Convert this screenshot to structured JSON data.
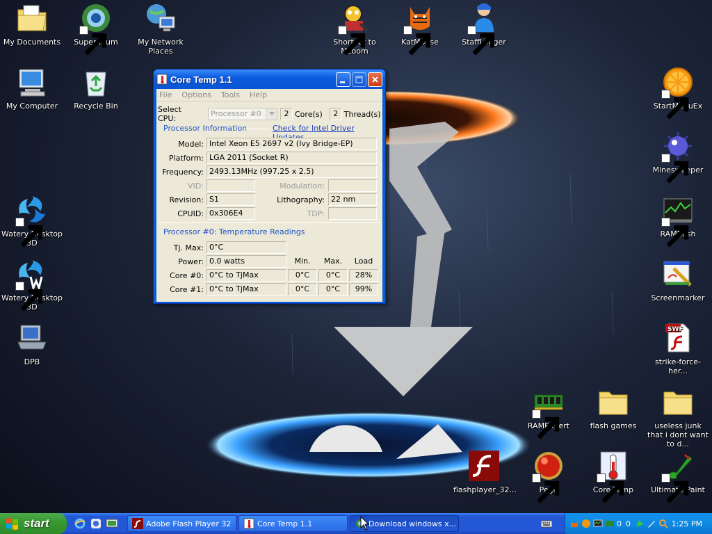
{
  "desktop": {
    "icons": [
      {
        "id": "my-documents",
        "label": "My Documents"
      },
      {
        "id": "supermium",
        "label": "Supermium"
      },
      {
        "id": "my-network-places",
        "label": "My Network Places"
      },
      {
        "id": "mzoom",
        "label": "Shortcut to Mzoom"
      },
      {
        "id": "katmouse",
        "label": "KatMouse"
      },
      {
        "id": "stafflogger",
        "label": "StaffLogger"
      },
      {
        "id": "my-computer",
        "label": "My Computer"
      },
      {
        "id": "recycle-bin",
        "label": "Recycle Bin"
      },
      {
        "id": "startmenuex",
        "label": "StartMenuEx"
      },
      {
        "id": "minesweeper",
        "label": "Minesweeper"
      },
      {
        "id": "watery-1",
        "label": "Watery Desktop 3D"
      },
      {
        "id": "ramrush",
        "label": "RAMRush"
      },
      {
        "id": "watery-2",
        "label": "Watery Desktop 3D"
      },
      {
        "id": "screenmarker",
        "label": "Screenmarker"
      },
      {
        "id": "dpb",
        "label": "DPB"
      },
      {
        "id": "strike-force",
        "label": "strike-force-her..."
      },
      {
        "id": "ramexpert",
        "label": "RAMExpert"
      },
      {
        "id": "flash-games",
        "label": "flash games"
      },
      {
        "id": "useless-junk",
        "label": "useless junk that i dont want to d..."
      },
      {
        "id": "flashplayer",
        "label": "flashplayer_32..."
      },
      {
        "id": "pego",
        "label": "Pego"
      },
      {
        "id": "core-temp",
        "label": "Core Temp"
      },
      {
        "id": "ultimate-paint",
        "label": "Ultimate Paint"
      }
    ]
  },
  "window": {
    "title": "Core Temp 1.1",
    "menu": [
      "File",
      "Options",
      "Tools",
      "Help"
    ],
    "select_cpu_label": "Select CPU:",
    "select_cpu_value": "Processor #0",
    "cores_value": "2",
    "cores_label": "Core(s)",
    "threads_value": "2",
    "threads_label": "Thread(s)",
    "proc_info_title": "Processor Information",
    "driver_link": "Check for Intel Driver Updates",
    "model_label": "Model:",
    "model_value": "Intel Xeon E5 2697 v2 (Ivy Bridge-EP)",
    "platform_label": "Platform:",
    "platform_value": "LGA 2011 (Socket R)",
    "frequency_label": "Frequency:",
    "frequency_value": "2493.13MHz (997.25 x 2.5)",
    "vid_label": "VID:",
    "modulation_label": "Modulation:",
    "revision_label": "Revision:",
    "revision_value": "S1",
    "lithography_label": "Lithography:",
    "lithography_value": "22 nm",
    "cpuid_label": "CPUID:",
    "cpuid_value": "0x306E4",
    "tdp_label": "TDP:",
    "temp_title": "Processor #0: Temperature Readings",
    "tjmax_label": "Tj. Max:",
    "tjmax_value": "0°C",
    "power_label": "Power:",
    "power_value": "0.0 watts",
    "col_min": "Min.",
    "col_max": "Max.",
    "col_load": "Load",
    "cores": [
      {
        "label": "Core #0:",
        "value": "0°C to TjMax",
        "min": "0°C",
        "max": "0°C",
        "load": "28%"
      },
      {
        "label": "Core #1:",
        "value": "0°C to TjMax",
        "min": "0°C",
        "max": "0°C",
        "load": "99%"
      }
    ]
  },
  "taskbar": {
    "start_label": "start",
    "tasks": [
      {
        "label": "Adobe Flash Player 32"
      },
      {
        "label": "Core Temp 1.1"
      },
      {
        "label": "Download windows x..."
      }
    ],
    "tray_num_1": "0",
    "tray_num_2": "0",
    "clock": "1:25 PM"
  },
  "colors": {
    "taskbar_blue": "#2457d6",
    "start_green": "#379a32",
    "window_blue": "#0a5fd8",
    "link_blue": "#1a3fc0",
    "group_title_blue": "#1f55c9"
  }
}
